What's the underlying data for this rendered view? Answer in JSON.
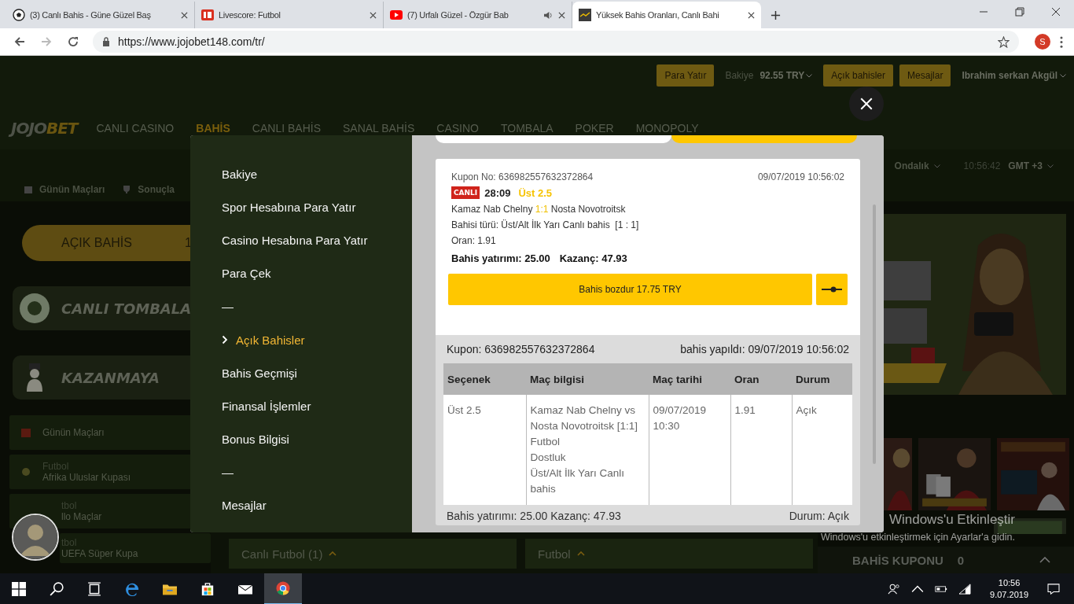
{
  "browser": {
    "tabs": [
      {
        "title": "(3) Canlı Bahis - Güne Güzel Baş",
        "audio": false,
        "selected": false
      },
      {
        "title": "Livescore: Futbol",
        "audio": false,
        "selected": false
      },
      {
        "title": "(7) Urfalı Güzel - Özgür Bab",
        "audio": true,
        "selected": false
      },
      {
        "title": "Yüksek Bahis Oranları, Canlı Bahi",
        "audio": false,
        "selected": true
      }
    ],
    "url": "https://www.jojobet148.com/tr/",
    "profile": "S"
  },
  "header": {
    "items": [
      {
        "kind": "button",
        "label": "Para Yatır"
      },
      {
        "kind": "balance",
        "label": "Bakiye",
        "value": "92.55 TRY"
      },
      {
        "kind": "button",
        "label": "Açık bahisler"
      },
      {
        "kind": "button",
        "label": "Mesajlar"
      },
      {
        "kind": "user",
        "label": "Ibrahim serkan Akgül"
      }
    ]
  },
  "logo": {
    "first": "JOJO",
    "second": "BET"
  },
  "nav": [
    {
      "label": "CANLI CASINO",
      "selected": false
    },
    {
      "label": "BAHİS",
      "selected": true
    },
    {
      "label": "CANLI BAHİS",
      "selected": false
    },
    {
      "label": "SANAL BAHİS",
      "selected": false
    },
    {
      "label": "CASINO",
      "selected": false
    },
    {
      "label": "TOMBALA",
      "selected": false
    },
    {
      "label": "POKER",
      "selected": false
    },
    {
      "label": "MONOPOLY",
      "selected": false
    }
  ],
  "subbar": {
    "links": [
      {
        "label": "Günün Maçları"
      },
      {
        "label": "Sonuçla"
      }
    ],
    "odds": "Ondalık",
    "time": "10:56:42",
    "timezone": "GMT +3"
  },
  "sidebar": {
    "open_bets": {
      "label": "AÇIK BAHİS",
      "count": "1"
    },
    "banners": [
      {
        "label": "CANLI TOMBALA"
      },
      {
        "label": "KAZANMAYA"
      }
    ],
    "items": [
      {
        "title": "Günün Maçları"
      },
      {
        "sport": "Futbol",
        "title": "Afrika Uluslar Kupası"
      },
      {
        "sport": "tbol",
        "title": "llo Maçlar"
      },
      {
        "sport": "tbol",
        "title": "UEFA Süper Kupa"
      }
    ]
  },
  "modal": {
    "menu": [
      {
        "kind": "link",
        "label": "Bakiye",
        "selected": false
      },
      {
        "kind": "link",
        "label": "Spor Hesabına Para Yatır",
        "selected": false
      },
      {
        "kind": "link",
        "label": "Casino Hesabına Para Yatır",
        "selected": false
      },
      {
        "kind": "link",
        "label": "Para Çek",
        "selected": false
      },
      {
        "kind": "separator",
        "label": "—"
      },
      {
        "kind": "link",
        "label": "Açık Bahisler",
        "selected": true
      },
      {
        "kind": "link",
        "label": "Bahis Geçmişi",
        "selected": false
      },
      {
        "kind": "link",
        "label": "Finansal İşlemler",
        "selected": false
      },
      {
        "kind": "link",
        "label": "Bonus Bilgisi",
        "selected": false
      },
      {
        "kind": "separator",
        "label": "—"
      },
      {
        "kind": "link",
        "label": "Mesajlar",
        "selected": false
      }
    ],
    "coupon": {
      "number": "Kupon No: 636982557632372864",
      "date": "09/07/2019 10:56:02",
      "live_badge": "CANLI",
      "minute": "28:09",
      "pick": "Üst 2.5",
      "home": "Kamaz Nab Chelny",
      "score": "1:1",
      "away": "Nosta Novotroitsk",
      "bet_type": "Bahisi türü: Üst/Alt İlk Yarı Canlı bahis  [1 : 1]",
      "odds": "Oran: 1.91",
      "stake": "Bahis yatırımı: 25.00",
      "win": "Kazanç: 47.93",
      "cashout": "Bahis bozdur 17.75 TRY"
    },
    "details": {
      "coupon": "Kupon: 636982557632372864",
      "placed": "bahis yapıldı: 09/07/2019 10:56:02",
      "columns": [
        "Seçenek",
        "Maç bilgisi",
        "Maç tarihi",
        "Oran",
        "Durum"
      ],
      "rows": [
        {
          "cells": [
            [
              "Üst 2.5"
            ],
            [
              "Kamaz Nab Chelny vs Nosta Novotroitsk [1:1]",
              "Futbol",
              "Dostluk",
              "Üst/Alt İlk Yarı Canlı bahis"
            ],
            [
              "09/07/2019 10:30"
            ],
            [
              "1.91"
            ],
            [
              "Açık"
            ]
          ]
        }
      ],
      "summary": "Bahis yatırımı: 25.00 Kazanç: 47.93",
      "status": "Durum: Açık"
    }
  },
  "bottom": {
    "sections": [
      "Canlı Futbol (1)",
      "Futbol"
    ],
    "coupon": {
      "label": "BAHİS KUPONU",
      "count": "0"
    }
  },
  "watermark": {
    "title": "Windows'u Etkinleştir",
    "text": "Windows'u etkinleştirmek için Ayarlar'a gidin."
  },
  "taskbar": {
    "apps": [
      {
        "kind": "windows"
      },
      {
        "kind": "search"
      },
      {
        "kind": "taskview"
      },
      {
        "kind": "edge"
      },
      {
        "kind": "folder"
      },
      {
        "kind": "store"
      },
      {
        "kind": "mail"
      },
      {
        "kind": "chrome",
        "active": true
      }
    ],
    "time": "10:56",
    "date": "9.07.2019"
  }
}
